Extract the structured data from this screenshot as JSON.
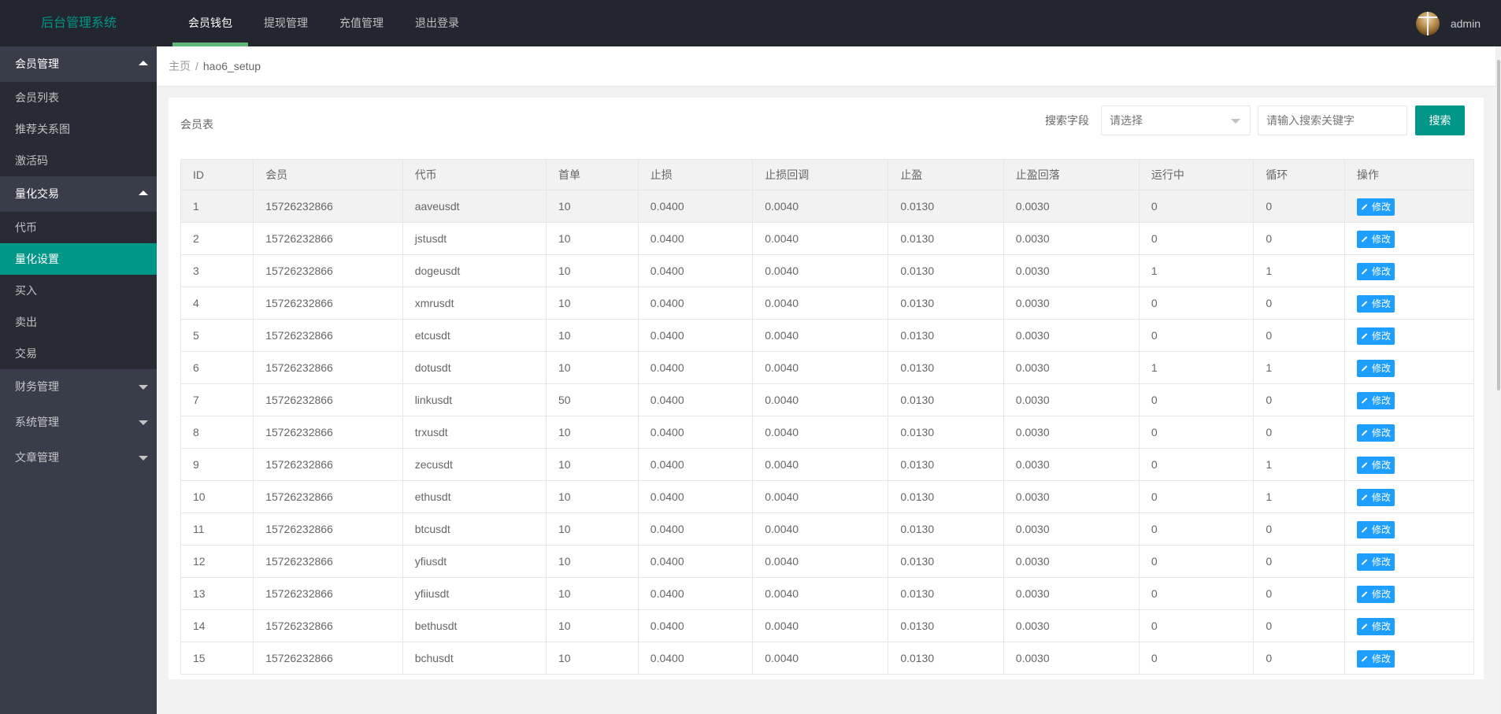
{
  "header": {
    "logo": "后台管理系统",
    "nav": [
      {
        "label": "会员钱包",
        "active": true
      },
      {
        "label": "提现管理",
        "active": false
      },
      {
        "label": "充值管理",
        "active": false
      },
      {
        "label": "退出登录",
        "active": false
      }
    ],
    "user": {
      "name": "admin",
      "avatar_icon": "user-avatar"
    }
  },
  "sidebar": {
    "groups": [
      {
        "label": "会员管理",
        "expanded": true,
        "items": [
          {
            "label": "会员列表",
            "active": false
          },
          {
            "label": "推荐关系图",
            "active": false
          },
          {
            "label": "激活码",
            "active": false
          }
        ]
      },
      {
        "label": "量化交易",
        "expanded": true,
        "items": [
          {
            "label": "代币",
            "active": false
          },
          {
            "label": "量化设置",
            "active": true
          },
          {
            "label": "买入",
            "active": false
          },
          {
            "label": "卖出",
            "active": false
          },
          {
            "label": "交易",
            "active": false
          }
        ]
      },
      {
        "label": "财务管理",
        "expanded": false,
        "items": []
      },
      {
        "label": "系统管理",
        "expanded": false,
        "items": []
      },
      {
        "label": "文章管理",
        "expanded": false,
        "items": []
      }
    ]
  },
  "breadcrumb": {
    "home": "主页",
    "separator": "/",
    "current": "hao6_setup"
  },
  "card": {
    "title": "会员表",
    "search": {
      "field_label": "搜索字段",
      "select_placeholder": "请选择",
      "keyword_placeholder": "请输入搜索关键字",
      "button_label": "搜索"
    }
  },
  "table": {
    "columns": [
      "ID",
      "会员",
      "代币",
      "首单",
      "止损",
      "止损回调",
      "止盈",
      "止盈回落",
      "运行中",
      "循环",
      "操作"
    ],
    "action_label": "修改",
    "rows": [
      {
        "id": "1",
        "member": "15726232866",
        "coin": "aaveusdt",
        "first_order": "10",
        "stop_loss": "0.0400",
        "stop_loss_pullback": "0.0040",
        "take_profit": "0.0130",
        "take_profit_pullback": "0.0030",
        "running": "0",
        "loop": "0"
      },
      {
        "id": "2",
        "member": "15726232866",
        "coin": "jstusdt",
        "first_order": "10",
        "stop_loss": "0.0400",
        "stop_loss_pullback": "0.0040",
        "take_profit": "0.0130",
        "take_profit_pullback": "0.0030",
        "running": "0",
        "loop": "0"
      },
      {
        "id": "3",
        "member": "15726232866",
        "coin": "dogeusdt",
        "first_order": "10",
        "stop_loss": "0.0400",
        "stop_loss_pullback": "0.0040",
        "take_profit": "0.0130",
        "take_profit_pullback": "0.0030",
        "running": "1",
        "loop": "1"
      },
      {
        "id": "4",
        "member": "15726232866",
        "coin": "xmrusdt",
        "first_order": "10",
        "stop_loss": "0.0400",
        "stop_loss_pullback": "0.0040",
        "take_profit": "0.0130",
        "take_profit_pullback": "0.0030",
        "running": "0",
        "loop": "0"
      },
      {
        "id": "5",
        "member": "15726232866",
        "coin": "etcusdt",
        "first_order": "10",
        "stop_loss": "0.0400",
        "stop_loss_pullback": "0.0040",
        "take_profit": "0.0130",
        "take_profit_pullback": "0.0030",
        "running": "0",
        "loop": "0"
      },
      {
        "id": "6",
        "member": "15726232866",
        "coin": "dotusdt",
        "first_order": "10",
        "stop_loss": "0.0400",
        "stop_loss_pullback": "0.0040",
        "take_profit": "0.0130",
        "take_profit_pullback": "0.0030",
        "running": "1",
        "loop": "1"
      },
      {
        "id": "7",
        "member": "15726232866",
        "coin": "linkusdt",
        "first_order": "50",
        "stop_loss": "0.0400",
        "stop_loss_pullback": "0.0040",
        "take_profit": "0.0130",
        "take_profit_pullback": "0.0030",
        "running": "0",
        "loop": "0"
      },
      {
        "id": "8",
        "member": "15726232866",
        "coin": "trxusdt",
        "first_order": "10",
        "stop_loss": "0.0400",
        "stop_loss_pullback": "0.0040",
        "take_profit": "0.0130",
        "take_profit_pullback": "0.0030",
        "running": "0",
        "loop": "0"
      },
      {
        "id": "9",
        "member": "15726232866",
        "coin": "zecusdt",
        "first_order": "10",
        "stop_loss": "0.0400",
        "stop_loss_pullback": "0.0040",
        "take_profit": "0.0130",
        "take_profit_pullback": "0.0030",
        "running": "0",
        "loop": "1"
      },
      {
        "id": "10",
        "member": "15726232866",
        "coin": "ethusdt",
        "first_order": "10",
        "stop_loss": "0.0400",
        "stop_loss_pullback": "0.0040",
        "take_profit": "0.0130",
        "take_profit_pullback": "0.0030",
        "running": "0",
        "loop": "1"
      },
      {
        "id": "11",
        "member": "15726232866",
        "coin": "btcusdt",
        "first_order": "10",
        "stop_loss": "0.0400",
        "stop_loss_pullback": "0.0040",
        "take_profit": "0.0130",
        "take_profit_pullback": "0.0030",
        "running": "0",
        "loop": "0"
      },
      {
        "id": "12",
        "member": "15726232866",
        "coin": "yfiusdt",
        "first_order": "10",
        "stop_loss": "0.0400",
        "stop_loss_pullback": "0.0040",
        "take_profit": "0.0130",
        "take_profit_pullback": "0.0030",
        "running": "0",
        "loop": "0"
      },
      {
        "id": "13",
        "member": "15726232866",
        "coin": "yfiiusdt",
        "first_order": "10",
        "stop_loss": "0.0400",
        "stop_loss_pullback": "0.0040",
        "take_profit": "0.0130",
        "take_profit_pullback": "0.0030",
        "running": "0",
        "loop": "0"
      },
      {
        "id": "14",
        "member": "15726232866",
        "coin": "bethusdt",
        "first_order": "10",
        "stop_loss": "0.0400",
        "stop_loss_pullback": "0.0040",
        "take_profit": "0.0130",
        "take_profit_pullback": "0.0030",
        "running": "0",
        "loop": "0"
      },
      {
        "id": "15",
        "member": "15726232866",
        "coin": "bchusdt",
        "first_order": "10",
        "stop_loss": "0.0400",
        "stop_loss_pullback": "0.0040",
        "take_profit": "0.0130",
        "take_profit_pullback": "0.0030",
        "running": "0",
        "loop": "0"
      }
    ]
  },
  "colors": {
    "header_bg": "#23262e",
    "sidebar_bg": "#393d49",
    "sidebar_sub_bg": "#282b33",
    "accent": "#009688",
    "nav_indicator": "#5fb878",
    "edit_button": "#1e9fff"
  }
}
